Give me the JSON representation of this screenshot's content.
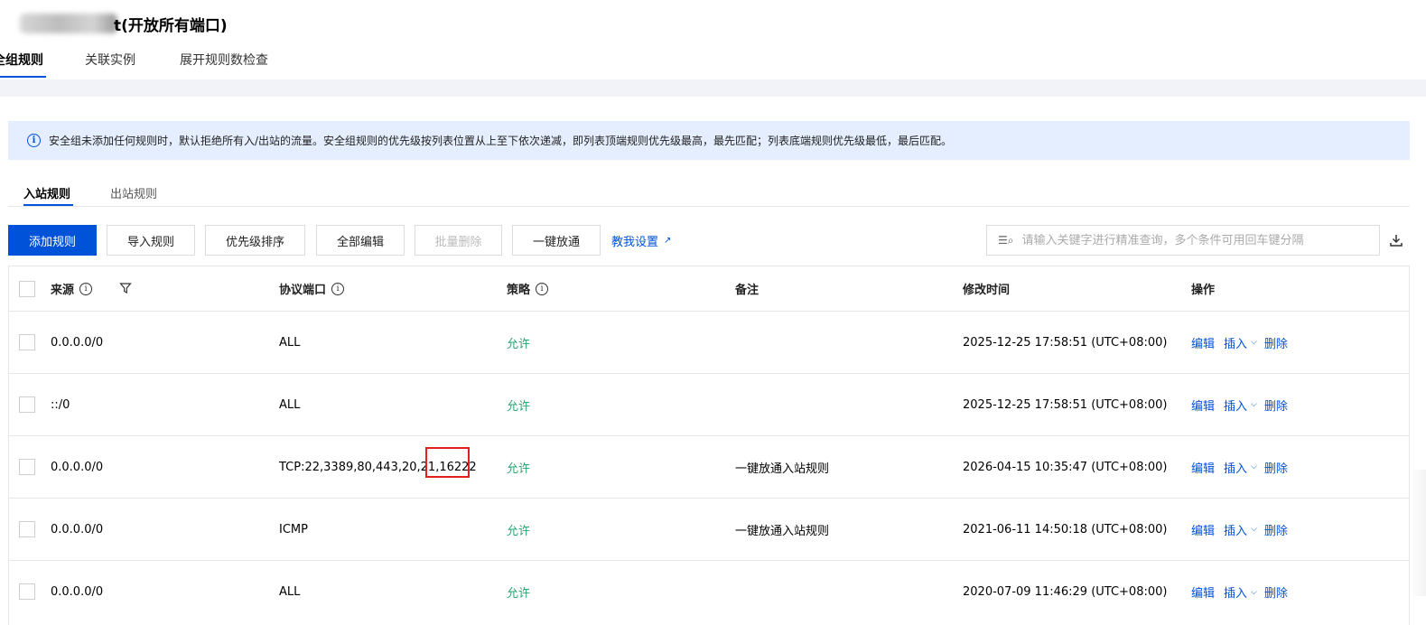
{
  "page": {
    "title_visible": "t(开放所有端口)"
  },
  "top_tabs": [
    {
      "label": "全组规则",
      "active": true
    },
    {
      "label": "关联实例",
      "active": false
    },
    {
      "label": "展开规则数检查",
      "active": false
    }
  ],
  "notice": {
    "icon": "info-icon",
    "text": "安全组未添加任何规则时，默认拒绝所有入/出站的流量。安全组规则的优先级按列表位置从上至下依次递减，即列表顶端规则优先级最高，最先匹配；列表底端规则优先级最低，最后匹配。"
  },
  "sub_tabs": [
    {
      "label": "入站规则",
      "active": true
    },
    {
      "label": "出站规则",
      "active": false
    }
  ],
  "toolbar": {
    "add_rule": "添加规则",
    "import_rule": "导入规则",
    "priority_sort": "优先级排序",
    "edit_all": "全部编辑",
    "batch_delete": "批量删除",
    "one_click_open": "一键放通",
    "teach_me": "教我设置"
  },
  "search": {
    "placeholder": "请输入关键字进行精准查询，多个条件可用回车键分隔",
    "icon": "filter-search-icon"
  },
  "table": {
    "columns": [
      "来源",
      "协议端口",
      "策略",
      "备注",
      "修改时间",
      "操作"
    ],
    "rows": [
      {
        "source": "0.0.0.0/0",
        "protocol": "ALL",
        "policy": "允许",
        "remark": "",
        "modified": "2025-12-25 17:58:51 (UTC+08:00)"
      },
      {
        "source": "::/0",
        "protocol": "ALL",
        "policy": "允许",
        "remark": "",
        "modified": "2025-12-25 17:58:51 (UTC+08:00)"
      },
      {
        "source": "0.0.0.0/0",
        "protocol": "TCP:22,3389,80,443,20,21,16222",
        "policy": "允许",
        "remark": "一键放通入站规则",
        "modified": "2026-04-15 10:35:47 (UTC+08:00)"
      },
      {
        "source": "0.0.0.0/0",
        "protocol": "ICMP",
        "policy": "允许",
        "remark": "一键放通入站规则",
        "modified": "2021-06-11 14:50:18 (UTC+08:00)"
      },
      {
        "source": "0.0.0.0/0",
        "protocol": "ALL",
        "policy": "允许",
        "remark": "",
        "modified": "2020-07-09 11:46:29 (UTC+08:00)"
      }
    ],
    "actions": {
      "edit": "编辑",
      "insert": "插入",
      "delete": "删除"
    }
  },
  "colors": {
    "primary": "#0052d9",
    "allow": "#2ba471",
    "notice_bg": "#e5eefe",
    "highlight": "#e02020"
  }
}
